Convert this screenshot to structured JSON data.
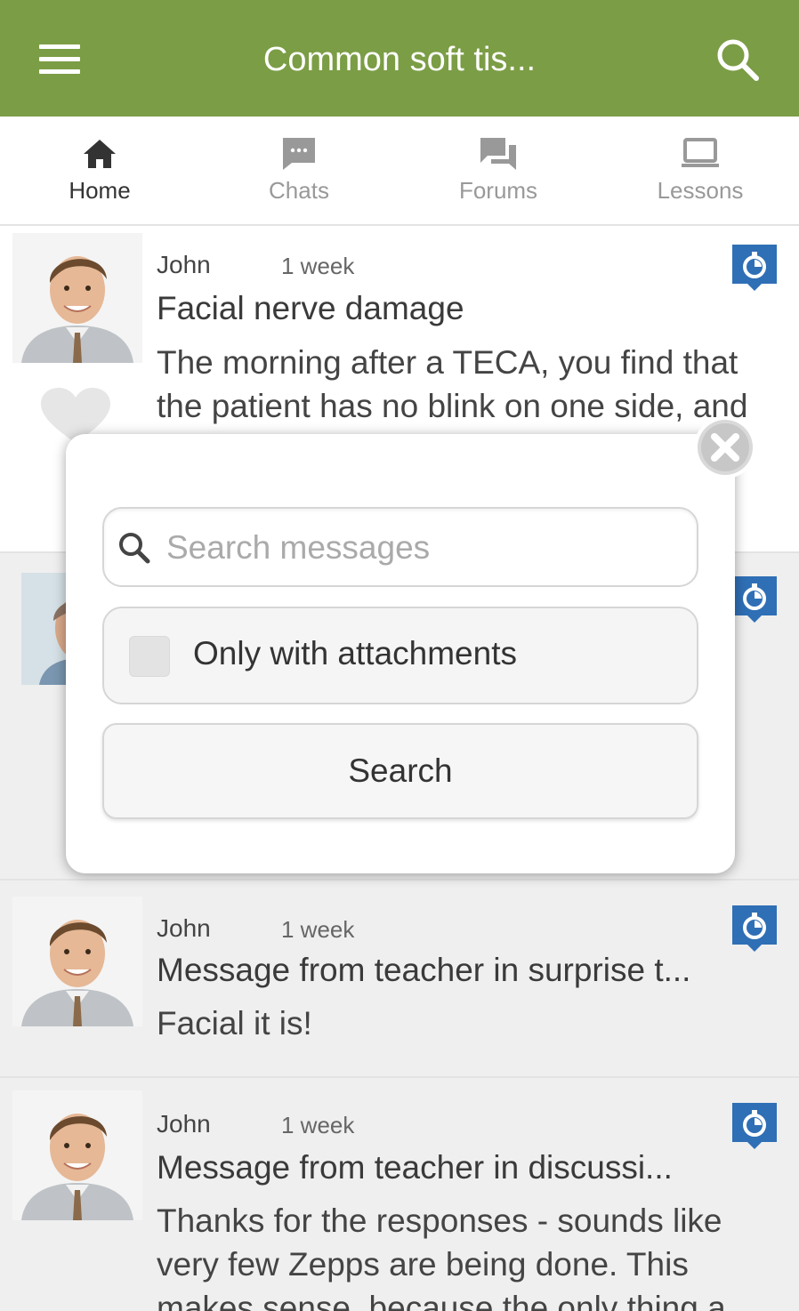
{
  "header": {
    "title": "Common soft tis...",
    "menu_icon": "hamburger-menu-icon",
    "search_icon": "search-icon",
    "color": "#7b9d45"
  },
  "tabs": [
    {
      "label": "Home",
      "icon": "home-icon",
      "active": true
    },
    {
      "label": "Chats",
      "icon": "chat-bubble-icon",
      "active": false
    },
    {
      "label": "Forums",
      "icon": "forum-icon",
      "active": false
    },
    {
      "label": "Lessons",
      "icon": "laptop-icon",
      "active": false
    }
  ],
  "feed": [
    {
      "author": "John",
      "time": "1 week",
      "title": "Facial nerve damage",
      "body": "The morning after a TECA, you find that the patient has no blink on one side, and",
      "badge_icon": "stopwatch-icon"
    },
    {
      "author": "John",
      "time": "1 week",
      "title": "Message from teacher in surprise t...",
      "body": "Facial it is!",
      "badge_icon": "stopwatch-icon"
    },
    {
      "author": "John",
      "time": "1 week",
      "title": "Message from teacher in discussi...",
      "body": "Thanks for the responses - sounds like very few Zepps are being done. This makes sense, because the only thing a",
      "badge_icon": "stopwatch-icon"
    }
  ],
  "modal": {
    "search_placeholder": "Search messages",
    "search_value": "",
    "attachments_label": "Only with attachments",
    "attachments_checked": false,
    "search_button": "Search",
    "close_icon": "close-circle-icon"
  },
  "colors": {
    "accent": "#7b9d45",
    "badge": "#2f6fb5"
  }
}
